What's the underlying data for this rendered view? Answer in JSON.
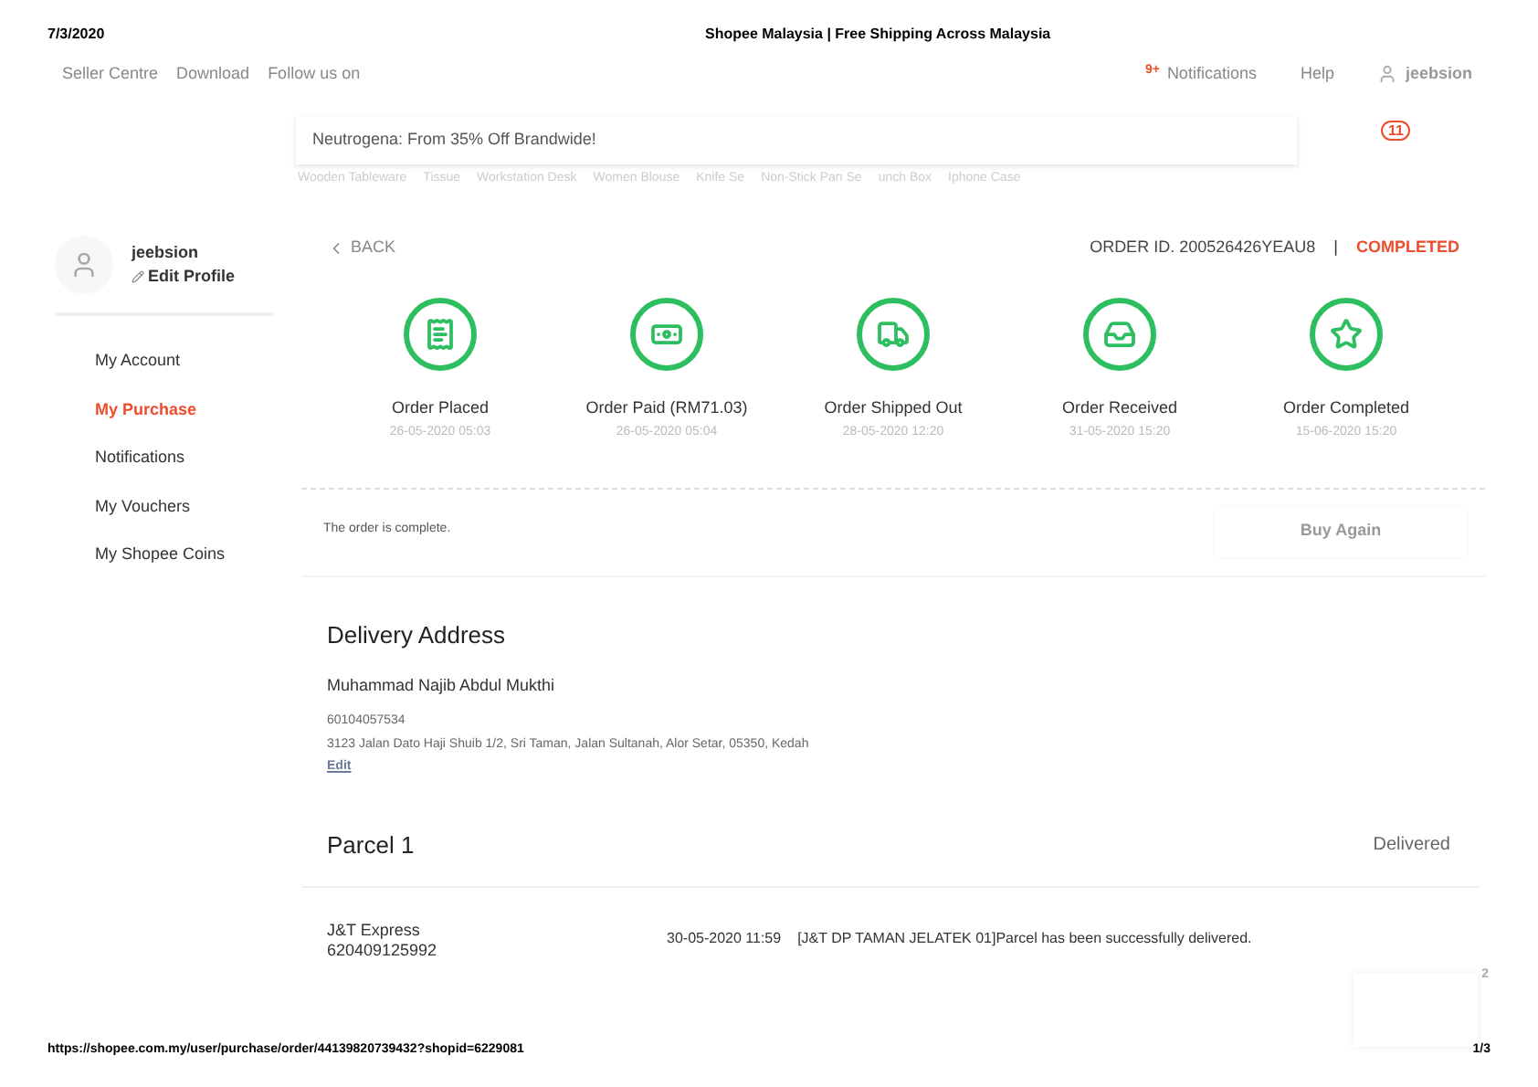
{
  "print_header": {
    "date": "7/3/2020",
    "title": "Shopee Malaysia | Free Shipping Across Malaysia"
  },
  "top_nav": {
    "left_links": [
      "Seller Centre",
      "Download",
      "Follow us on"
    ],
    "notifications_badge": "9+",
    "notifications": "Notifications",
    "help": "Help",
    "username": "jeebsion"
  },
  "search": {
    "value": "Neutrogena: From 35% Off Brandwide!",
    "keywords": [
      "Wooden Tableware",
      "Tissue",
      "Workstation Desk",
      "Women Blouse",
      "Knife Se",
      "Non-Stick Pan Se",
      "unch Box",
      "Iphone Case"
    ],
    "cart_count": "11"
  },
  "sidebar": {
    "username": "jeebsion",
    "edit_profile": "Edit Profile",
    "items": [
      {
        "label": "My Account",
        "selected": false
      },
      {
        "label": "My Purchase",
        "selected": true
      },
      {
        "label": "Notifications",
        "selected": false
      },
      {
        "label": "My Vouchers",
        "selected": false
      },
      {
        "label": "My Shopee Coins",
        "selected": false
      }
    ]
  },
  "order": {
    "back": "BACK",
    "order_id": "ORDER ID. 200526426YEAU8",
    "separator": "|",
    "status": "COMPLETED",
    "steps": [
      {
        "kind": "placed",
        "label": "Order Placed",
        "time": "26-05-2020 05:03"
      },
      {
        "kind": "paid",
        "label": "Order Paid (RM71.03)",
        "time": "26-05-2020 05:04"
      },
      {
        "kind": "shipped",
        "label": "Order Shipped Out",
        "time": "28-05-2020 12:20"
      },
      {
        "kind": "received",
        "label": "Order Received",
        "time": "31-05-2020 15:20"
      },
      {
        "kind": "completed",
        "label": "Order Completed",
        "time": "15-06-2020 15:20"
      }
    ],
    "message": "The order is complete.",
    "buy_again": "Buy Again"
  },
  "delivery": {
    "title": "Delivery Address",
    "name": "Muhammad Najib Abdul Mukthi",
    "phone": "60104057534",
    "address": "3123 Jalan Dato Haji Shuib 1/2, Sri Taman, Jalan Sultanah, Alor Setar, 05350, Kedah",
    "edit": "Edit"
  },
  "parcel": {
    "title": "Parcel 1",
    "status": "Delivered",
    "courier": "J&T Express",
    "tracking": "620409125992",
    "time": "30-05-2020 11:59",
    "event": "[J&T DP TAMAN JELATEK 01]Parcel has been successfully delivered.",
    "chat_badge": "2"
  },
  "print_footer": {
    "url": "https://shopee.com.my/user/purchase/order/44139820739432?shopid=6229081",
    "page": "1/3"
  }
}
